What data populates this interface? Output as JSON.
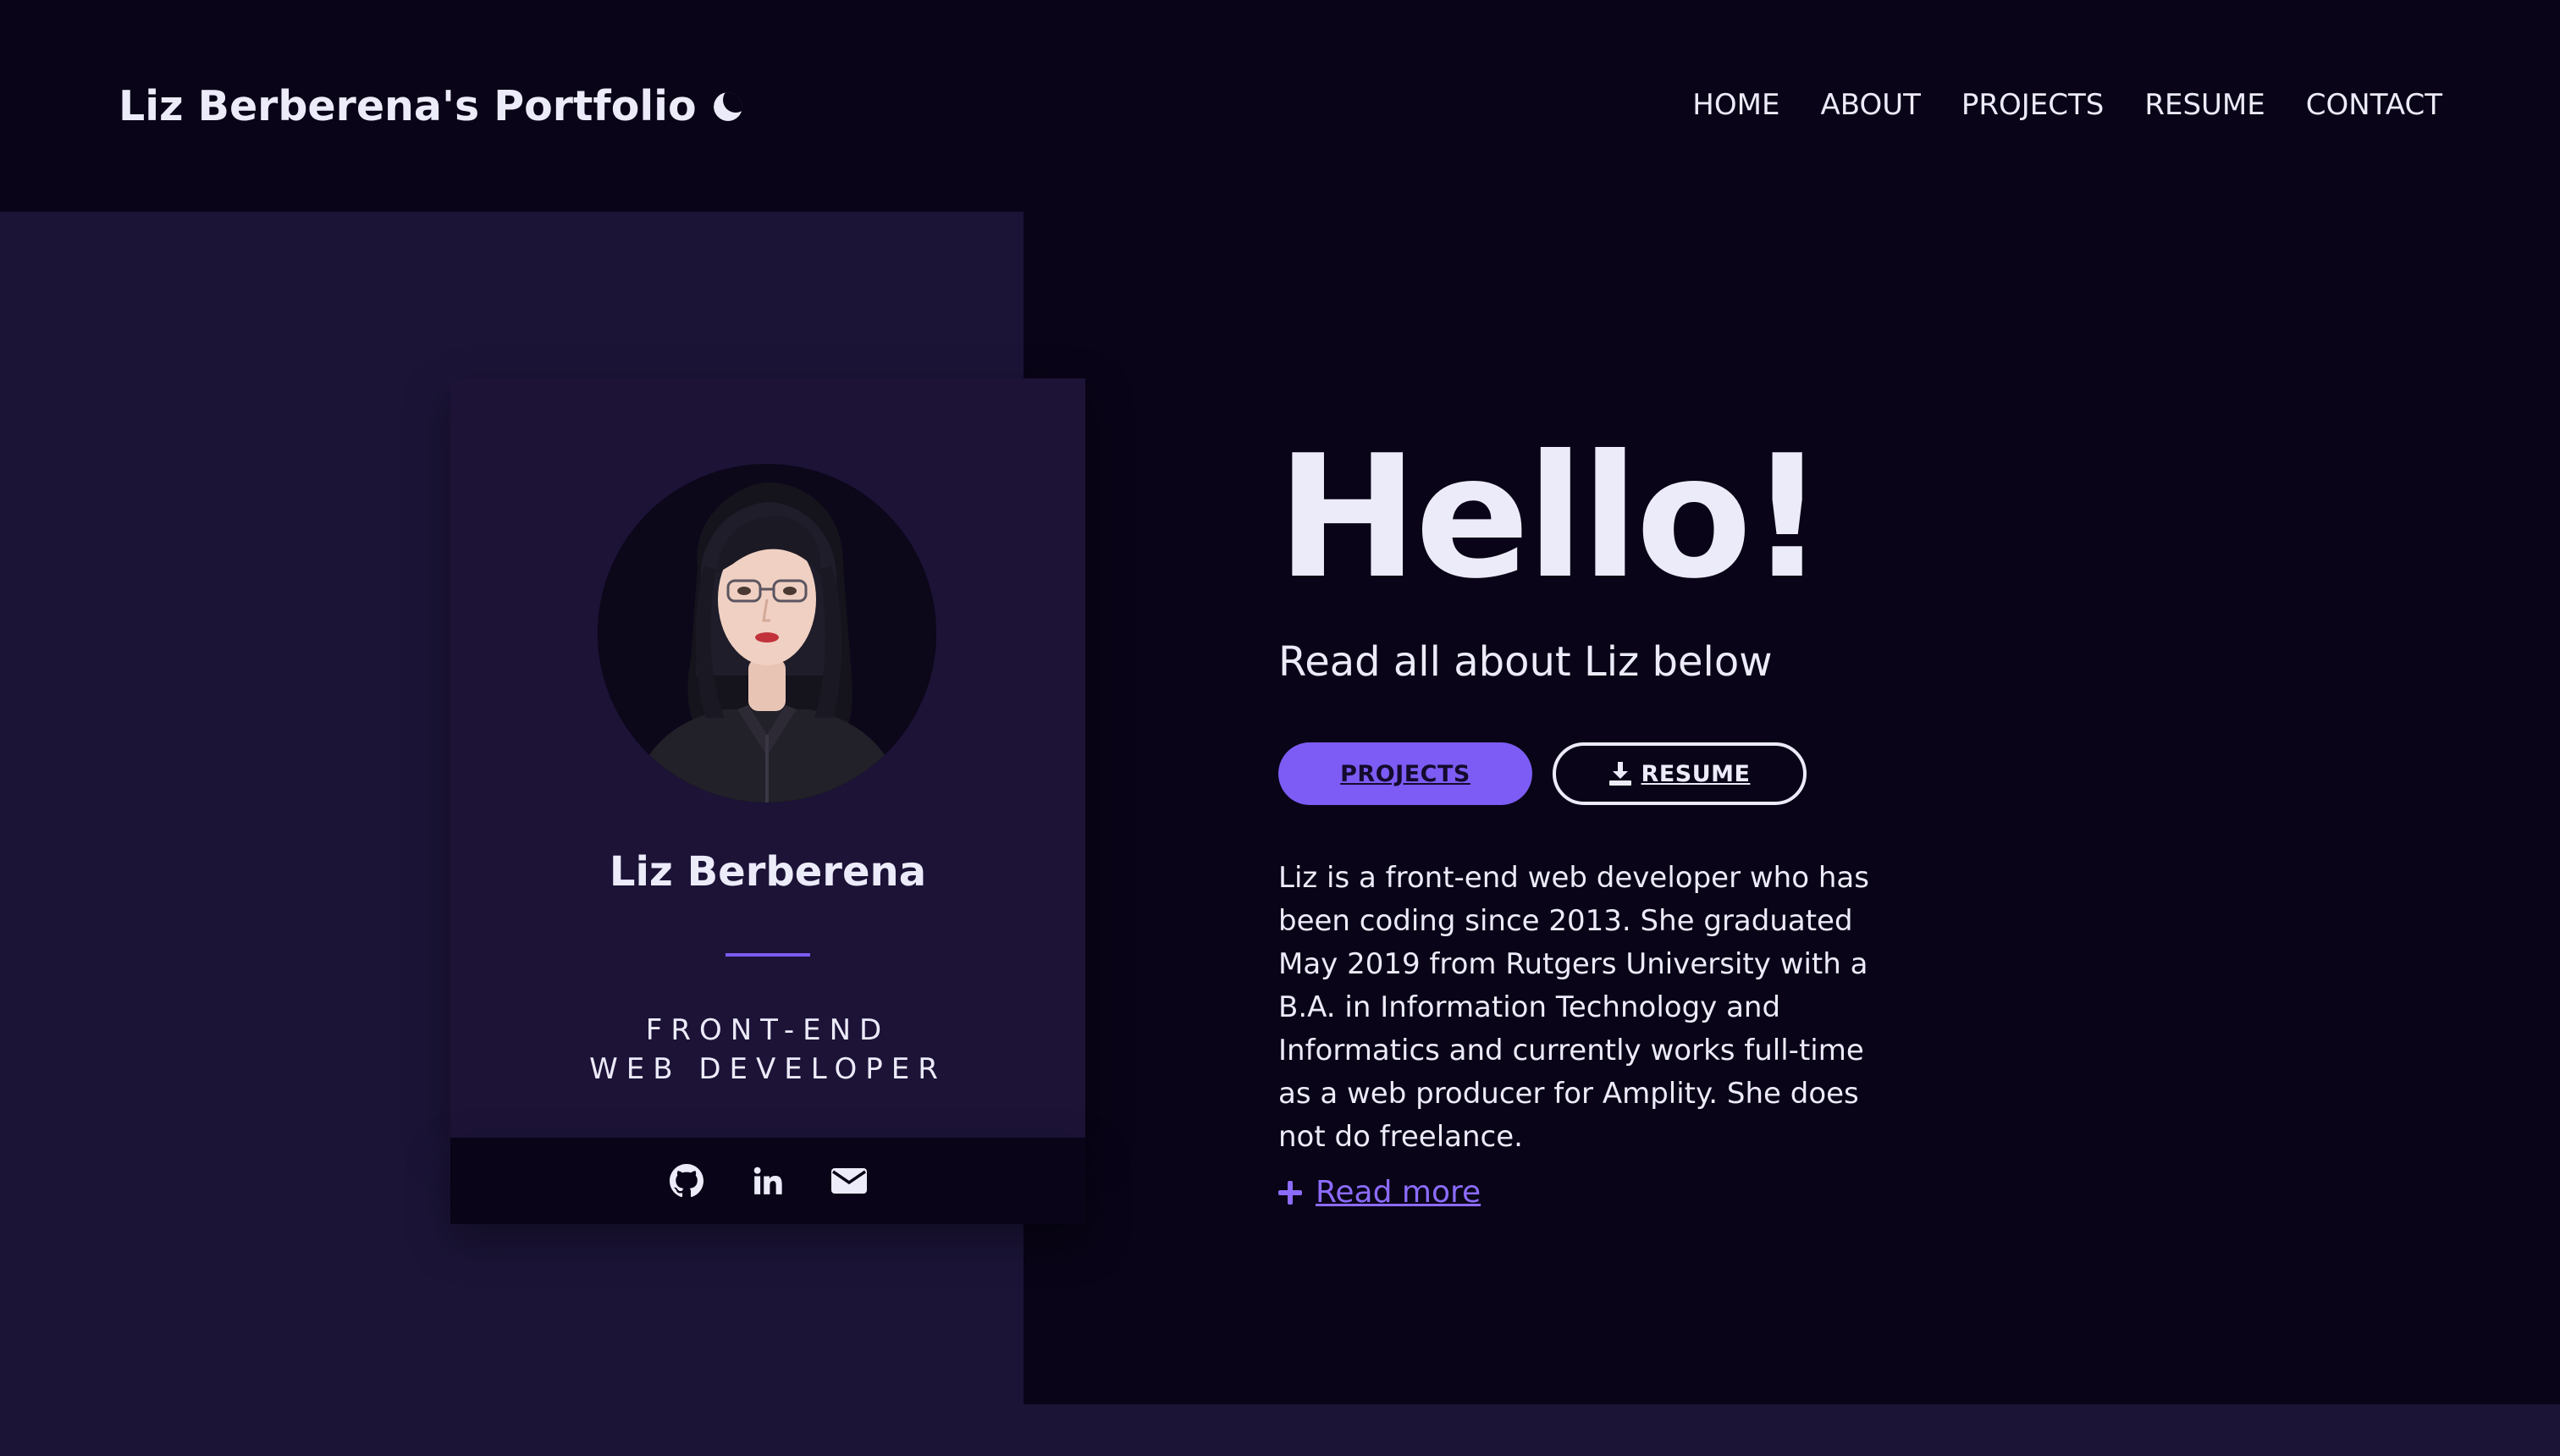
{
  "header": {
    "brand": "Liz Berberena's Portfolio",
    "brand_icon": "moon-icon",
    "nav": [
      {
        "label": "HOME"
      },
      {
        "label": "ABOUT"
      },
      {
        "label": "PROJECTS"
      },
      {
        "label": "RESUME"
      },
      {
        "label": "CONTACT"
      }
    ]
  },
  "card": {
    "name": "Liz Berberena",
    "role_line1": "FRONT-END",
    "role_line2": "WEB DEVELOPER",
    "social": [
      "github-icon",
      "linkedin-icon",
      "email-icon"
    ]
  },
  "hero": {
    "heading": "Hello!",
    "subtitle": "Read all about Liz below",
    "projects_button": "PROJECTS",
    "resume_button": "RESUME",
    "bio": "Liz is a front-end web developer who has been coding since 2013. She graduated May 2019 from Rutgers University with a B.A. in Information Technology and Informatics and currently works full-time as a web producer for Amplity. She does not do freelance.",
    "read_more": "Read more"
  },
  "colors": {
    "background": "#1b1437",
    "panel": "#090417",
    "accent": "#7c5cf4",
    "text": "#ecebfa"
  }
}
